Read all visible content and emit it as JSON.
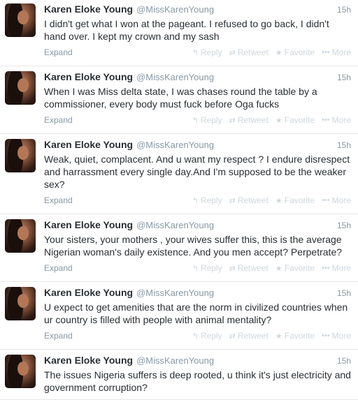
{
  "tweets": [
    {
      "name": "Karen Eloke Young",
      "handle": "@MissKarenYoung",
      "time": "15h",
      "text": "I didn't get what I won at the pageant. I refused to go back, I didn't hand over. I kept my crown and my sash",
      "expand": "Expand"
    },
    {
      "name": "Karen Eloke Young",
      "handle": "@MissKarenYoung",
      "time": "15h",
      "text": "When I was Miss delta state, I was chases round the table by a commissioner, every body must fuck before Oga fucks",
      "expand": "Expand"
    },
    {
      "name": "Karen Eloke Young",
      "handle": "@MissKarenYoung",
      "time": "15h",
      "text": "Weak, quiet, complacent. And u want my respect ? I endure disrespect and harrassment every single day.And I'm supposed to be the weaker sex?",
      "expand": "Expand"
    },
    {
      "name": "Karen Eloke Young",
      "handle": "@MissKarenYoung",
      "time": "15h",
      "text": "Your sisters, your mothers , your wives suffer this, this is the average Nigerian woman's daily existence. And you men accept? Perpetrate?",
      "expand": "Expand"
    },
    {
      "name": "Karen Eloke Young",
      "handle": "@MissKarenYoung",
      "time": "15h",
      "text": "U expect to get amenities that are the norm in civilized countries when ur country is filled with people with animal mentality?",
      "expand": "Expand"
    },
    {
      "name": "Karen Eloke Young",
      "handle": "@MissKarenYoung",
      "time": "15h",
      "text": "The issues Nigeria suffers is deep rooted, u think it's just electricity and government corruption?",
      "expand": ""
    }
  ],
  "actions": {
    "reply": "Reply",
    "retweet": "Retweet",
    "favorite": "Favorite",
    "more": "More"
  },
  "icons": {
    "reply": "reply-icon",
    "retweet": "retweet-icon",
    "favorite": "star-icon",
    "more": "dots-icon"
  },
  "colors": {
    "name": "#292f33",
    "meta": "#8899a6",
    "action": "#cfd7dc",
    "divider": "#e8e8e8"
  }
}
